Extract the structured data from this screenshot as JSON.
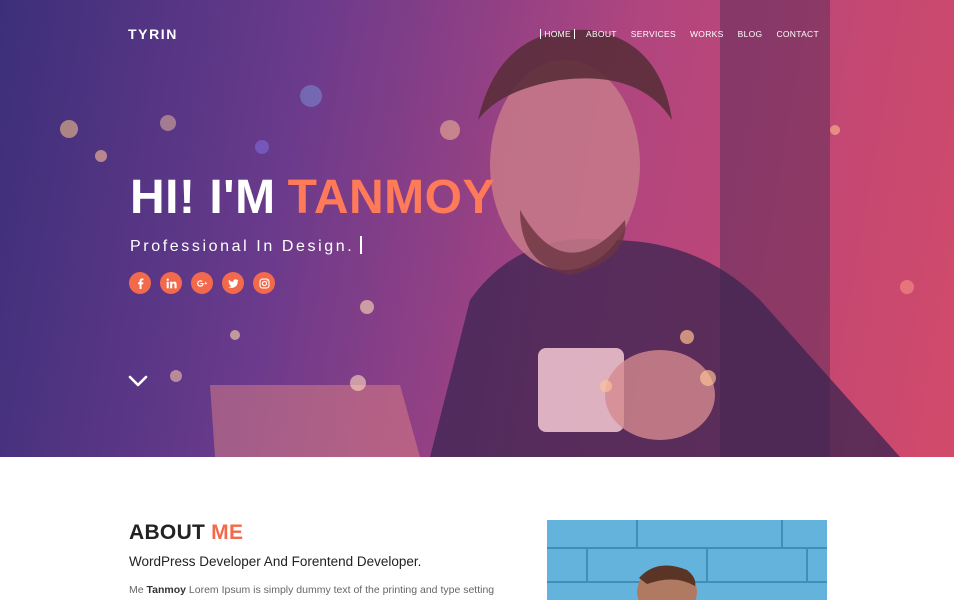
{
  "nav": {
    "logo": "TYRIN",
    "items": [
      {
        "label": "HOME",
        "active": true
      },
      {
        "label": "ABOUT",
        "active": false
      },
      {
        "label": "SERVICES",
        "active": false
      },
      {
        "label": "WORKS",
        "active": false
      },
      {
        "label": "BLOG",
        "active": false
      },
      {
        "label": "CONTACT",
        "active": false
      }
    ]
  },
  "hero": {
    "greeting": "HI! I'M",
    "name": "TANMOY",
    "subtitle": "Professional In Design.",
    "social": [
      {
        "icon": "facebook-icon"
      },
      {
        "icon": "linkedin-icon"
      },
      {
        "icon": "google-plus-icon"
      },
      {
        "icon": "twitter-icon"
      },
      {
        "icon": "instagram-icon"
      }
    ],
    "accent_color": "#f26a4b"
  },
  "about": {
    "title": "ABOUT",
    "title_accent": "ME",
    "subtitle": "WordPress Developer And Forentend Developer.",
    "text_prefix": "Me",
    "text_name": "Tanmoy",
    "text_rest": "Lorem Ipsum is simply dummy text of the printing and type setting"
  }
}
